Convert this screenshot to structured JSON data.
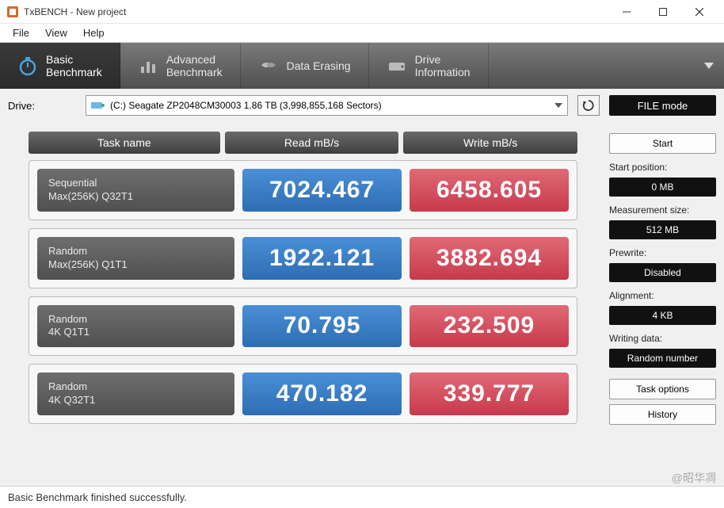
{
  "window": {
    "title": "TxBENCH - New project"
  },
  "menu": {
    "file": "File",
    "view": "View",
    "help": "Help"
  },
  "tabs": {
    "basic1": "Basic",
    "basic2": "Benchmark",
    "advanced1": "Advanced",
    "advanced2": "Benchmark",
    "erasing": "Data Erasing",
    "drive1": "Drive",
    "drive2": "Information"
  },
  "drive": {
    "label": "Drive:",
    "text": "(C:) Seagate ZP2048CM30003   1.86 TB (3,998,855,168 Sectors)"
  },
  "filemode": "FILE mode",
  "headers": {
    "task": "Task name",
    "read": "Read mB/s",
    "write": "Write mB/s"
  },
  "rows": [
    {
      "name1": "Sequential",
      "name2": "Max(256K) Q32T1",
      "read": "7024.467",
      "write": "6458.605"
    },
    {
      "name1": "Random",
      "name2": "Max(256K) Q1T1",
      "read": "1922.121",
      "write": "3882.694"
    },
    {
      "name1": "Random",
      "name2": "4K Q1T1",
      "read": "70.795",
      "write": "232.509"
    },
    {
      "name1": "Random",
      "name2": "4K Q32T1",
      "read": "470.182",
      "write": "339.777"
    }
  ],
  "side": {
    "start": "Start",
    "startpos_label": "Start position:",
    "startpos_value": "0 MB",
    "meassize_label": "Measurement size:",
    "meassize_value": "512 MB",
    "prewrite_label": "Prewrite:",
    "prewrite_value": "Disabled",
    "alignment_label": "Alignment:",
    "alignment_value": "4 KB",
    "writing_label": "Writing data:",
    "writing_value": "Random number",
    "taskoptions": "Task options",
    "history": "History"
  },
  "status": "Basic Benchmark finished successfully.",
  "watermark": "@昭华凋"
}
